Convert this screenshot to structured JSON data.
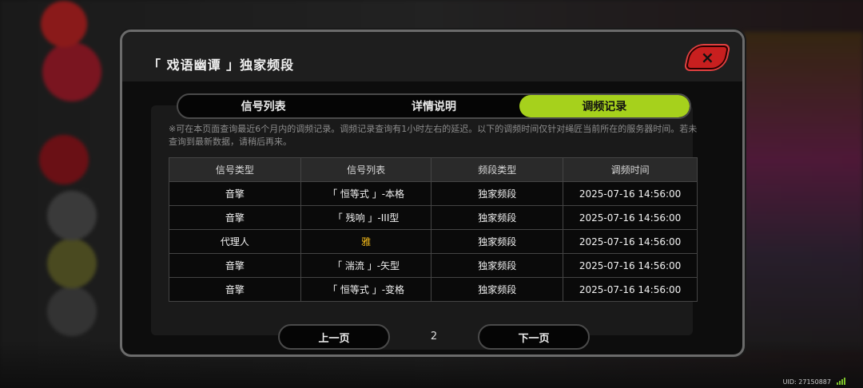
{
  "modal": {
    "title": "「 戏语幽谭 」独家频段",
    "close_icon": "×"
  },
  "tabs": [
    {
      "label": "信号列表"
    },
    {
      "label": "详情说明"
    },
    {
      "label": "调频记录"
    }
  ],
  "notice": "※可在本页面查询最近6个月内的调频记录。调频记录查询有1小时左右的延迟。以下的调频时间仅针对绳匠当前所在的服务器时间。若未查询到最新数据，请稍后再来。",
  "table": {
    "headers": [
      "信号类型",
      "信号列表",
      "频段类型",
      "调频时间"
    ],
    "rows": [
      [
        "音擎",
        "「 恒等式 」-本格",
        "独家频段",
        "2025-07-16 14:56:00"
      ],
      [
        "音擎",
        "「 残响 」-III型",
        "独家频段",
        "2025-07-16 14:56:00"
      ],
      [
        "代理人",
        "雅",
        "独家频段",
        "2025-07-16 14:56:00"
      ],
      [
        "音擎",
        "「 湍流 」-矢型",
        "独家频段",
        "2025-07-16 14:56:00"
      ],
      [
        "音擎",
        "「 恒等式 」-变格",
        "独家频段",
        "2025-07-16 14:56:00"
      ]
    ]
  },
  "pager": {
    "prev_label": "上一页",
    "page": "2",
    "next_label": "下一页"
  },
  "footer": {
    "uid": "UID: 27150887"
  },
  "colors": {
    "accent": "#a6d11c",
    "gold": "#f2b91a",
    "close": "#c81f1f"
  }
}
